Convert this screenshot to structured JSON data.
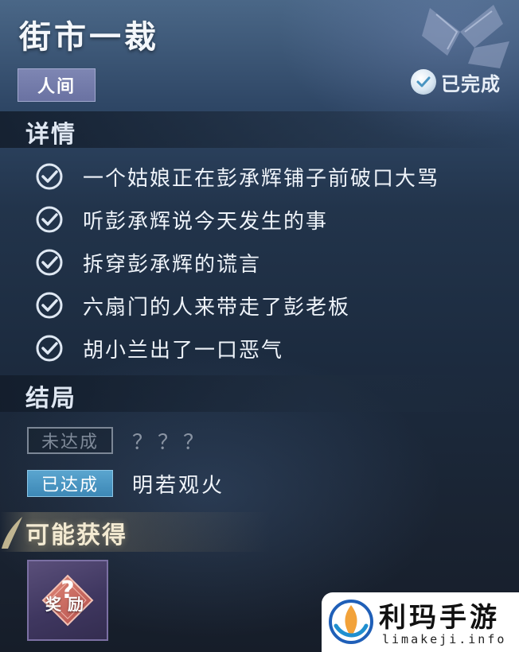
{
  "quest": {
    "title": "街市一裁",
    "world_tag": "人间",
    "status_label": "已完成"
  },
  "details": {
    "header": "详情",
    "items": [
      {
        "text": "一个姑娘正在彭承辉铺子前破口大骂",
        "checked": true
      },
      {
        "text": "听彭承辉说今天发生的事",
        "checked": true
      },
      {
        "text": "拆穿彭承辉的谎言",
        "checked": true
      },
      {
        "text": "六扇门的人来带走了彭老板",
        "checked": true
      },
      {
        "text": "胡小兰出了一口恶气",
        "checked": true
      }
    ]
  },
  "endings": {
    "header": "结局",
    "rows": [
      {
        "badge": "未达成",
        "text": "？？？",
        "achieved": false
      },
      {
        "badge": "已达成",
        "text": "明若观火",
        "achieved": true
      }
    ]
  },
  "rewards": {
    "header": "可能获得",
    "items": [
      {
        "label": "奖励",
        "icon": "mystery-reward-icon"
      }
    ]
  },
  "watermark": {
    "title": "利玛手游",
    "domain": "limakeji.info"
  },
  "colors": {
    "accent_blue": "#4a95c2",
    "world_tag_bg": "#747ca9",
    "reward_card_bg": "#463e68"
  }
}
